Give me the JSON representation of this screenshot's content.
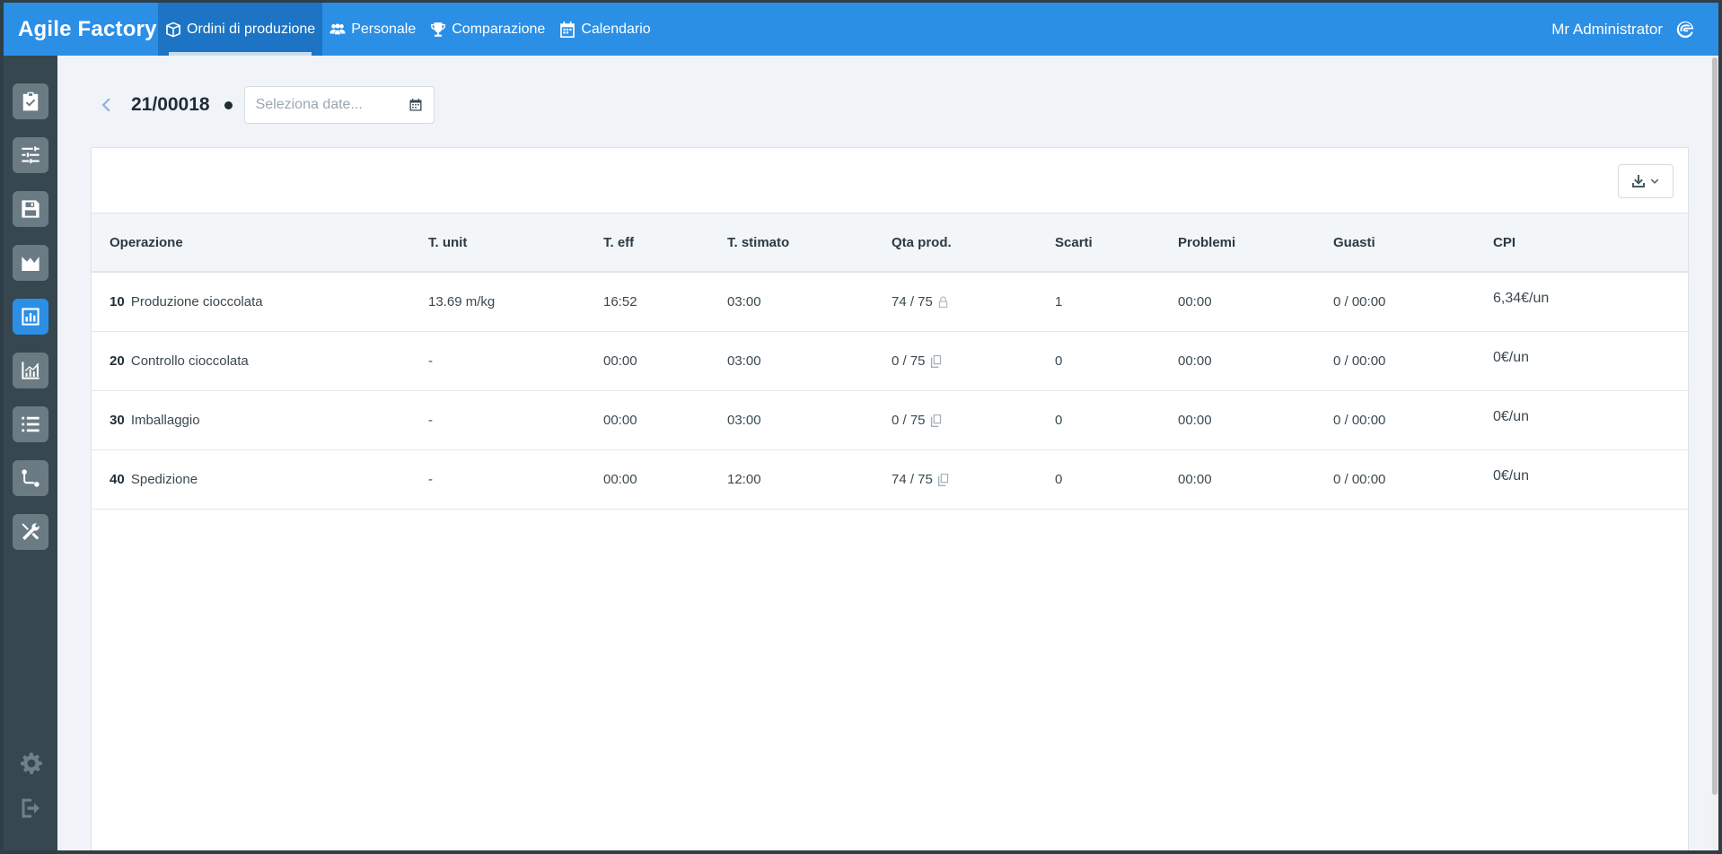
{
  "app": {
    "brand": "Agile Factory"
  },
  "nav": {
    "items": [
      {
        "label": "Ordini di produzione",
        "icon": "box-icon",
        "active": true
      },
      {
        "label": "Personale",
        "icon": "users-icon",
        "active": false
      },
      {
        "label": "Comparazione",
        "icon": "trophy-icon",
        "active": false
      },
      {
        "label": "Calendario",
        "icon": "calendar-icon",
        "active": false
      }
    ]
  },
  "user": {
    "name": "Mr Administrator",
    "icon": "brand-logo-icon"
  },
  "sidebar": {
    "items": [
      {
        "icon": "clipboard-check-icon"
      },
      {
        "icon": "filters-icon"
      },
      {
        "icon": "save-icon"
      },
      {
        "icon": "area-chart-icon"
      },
      {
        "icon": "bar-chart-icon",
        "active": true
      },
      {
        "icon": "line-chart-icon"
      },
      {
        "icon": "list-icon"
      },
      {
        "icon": "route-icon"
      },
      {
        "icon": "tools-icon"
      }
    ],
    "bottom": [
      {
        "icon": "gear-icon"
      },
      {
        "icon": "logout-icon"
      }
    ]
  },
  "header": {
    "order_id": "21/00018",
    "date_placeholder": "Seleziona date..."
  },
  "table": {
    "columns": [
      "Operazione",
      "T. unit",
      "T. eff",
      "T. stimato",
      "Qta prod.",
      "Scarti",
      "Problemi",
      "Guasti",
      "CPI"
    ],
    "rows": [
      {
        "num": "10",
        "name": "Produzione cioccolata",
        "t_unit": "13.69 m/kg",
        "t_eff": "16:52",
        "t_stimato": "03:00",
        "qta": "74 / 75",
        "qta_icon": "lock-icon",
        "scarti": "1",
        "problemi": "00:00",
        "guasti": "0 / 00:00",
        "cpi": "6,34€/un"
      },
      {
        "num": "20",
        "name": "Controllo cioccolata",
        "t_unit": "-",
        "t_eff": "00:00",
        "t_stimato": "03:00",
        "qta": "0 / 75",
        "qta_icon": "copy-icon",
        "scarti": "0",
        "problemi": "00:00",
        "guasti": "0 / 00:00",
        "cpi": "0€/un"
      },
      {
        "num": "30",
        "name": "Imballaggio",
        "t_unit": "-",
        "t_eff": "00:00",
        "t_stimato": "03:00",
        "qta": "0 / 75",
        "qta_icon": "copy-icon",
        "scarti": "0",
        "problemi": "00:00",
        "guasti": "0 / 00:00",
        "cpi": "0€/un"
      },
      {
        "num": "40",
        "name": "Spedizione",
        "t_unit": "-",
        "t_eff": "00:00",
        "t_stimato": "12:00",
        "qta": "74 / 75",
        "qta_icon": "copy-icon",
        "scarti": "0",
        "problemi": "00:00",
        "guasti": "0 / 00:00",
        "cpi": "0€/un"
      }
    ]
  },
  "colors": {
    "primary": "#2b8fe6",
    "sidebar": "#37474f",
    "background": "#f0f4f8"
  }
}
